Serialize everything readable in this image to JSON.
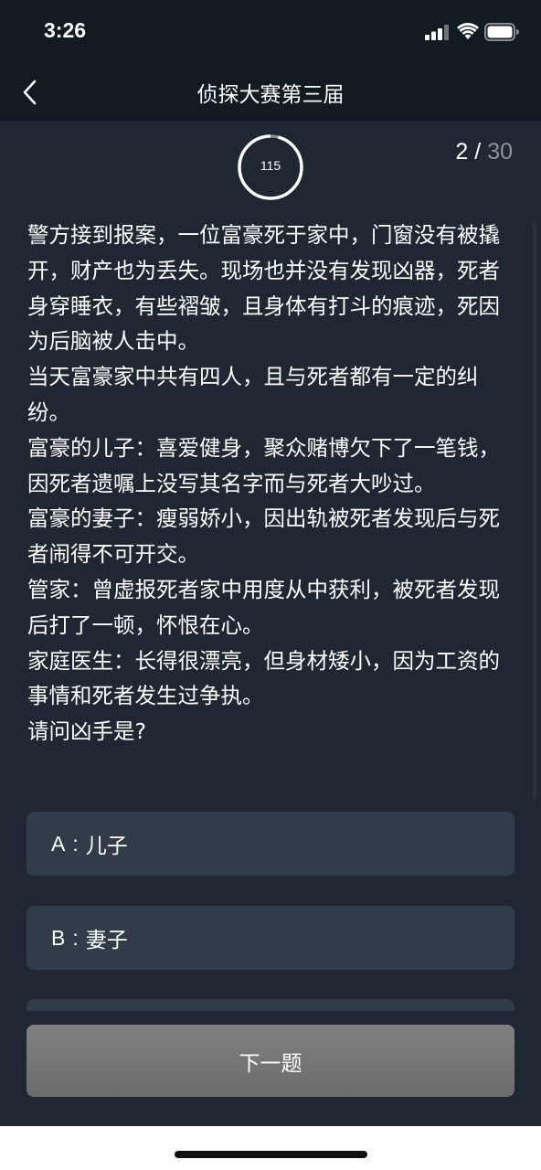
{
  "status_bar": {
    "time": "3:26"
  },
  "nav": {
    "title": "侦探大赛第三届"
  },
  "timer": {
    "value": "115",
    "fraction_remaining": 0.96
  },
  "progress": {
    "current": "2",
    "separator": "/",
    "total": "30"
  },
  "question": {
    "paragraphs": [
      "警方接到报案，一位富豪死于家中，门窗没有被撬开，财产也为丢失。现场也并没有发现凶器，死者身穿睡衣，有些褶皱，且身体有打斗的痕迹，死因为后脑被人击中。",
      "当天富豪家中共有四人，且与死者都有一定的纠纷。",
      "富豪的儿子：喜爱健身，聚众赌博欠下了一笔钱，因死者遗嘱上没写其名字而与死者大吵过。",
      "富豪的妻子：瘦弱娇小，因出轨被死者发现后与死者闹得不可开交。",
      "管家：曾虚报死者家中用度从中获利，被死者发现后打了一顿，怀恨在心。",
      "家庭医生：长得很漂亮，但身材矮小，因为工资的事情和死者发生过争执。",
      "请问凶手是?"
    ]
  },
  "options": [
    {
      "letter": "A",
      "sep": ":",
      "text": "儿子"
    },
    {
      "letter": "B",
      "sep": ":",
      "text": "妻子"
    }
  ],
  "next_button": {
    "label": "下一题"
  },
  "colors": {
    "background": "#1f2733",
    "header": "#121a22",
    "option_bg": "#323c48",
    "next_button": "#777777"
  }
}
